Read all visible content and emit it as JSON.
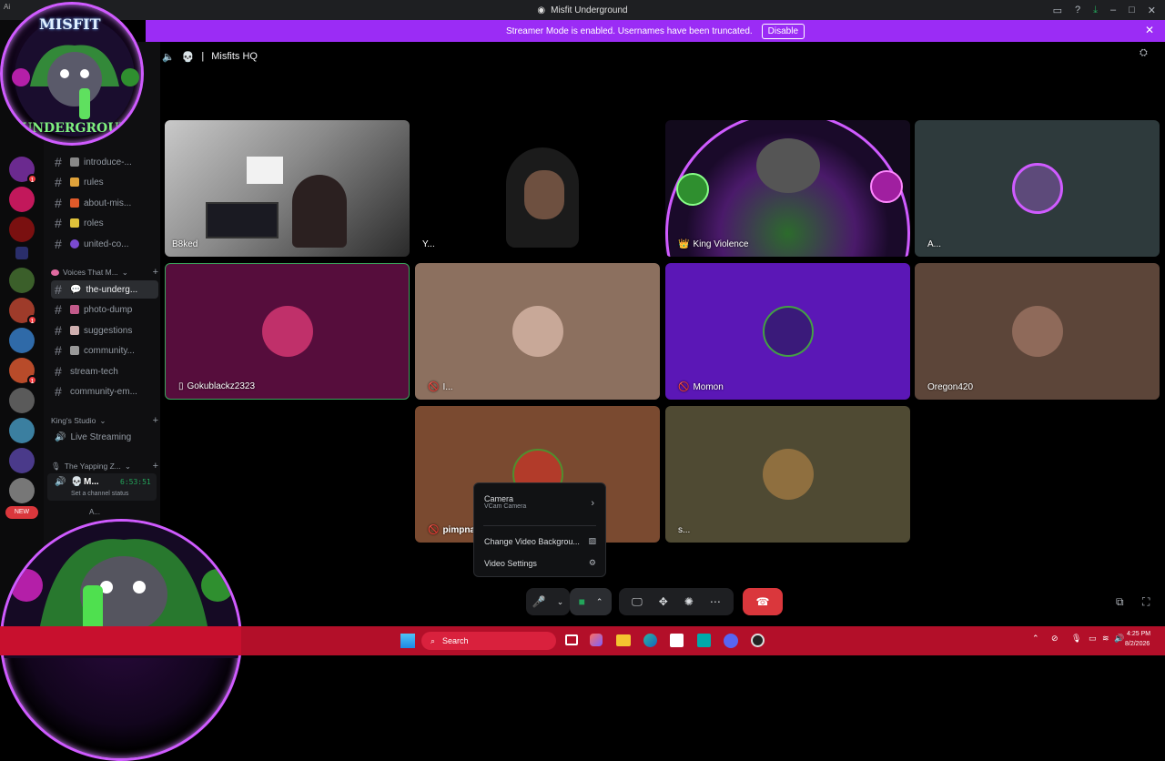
{
  "window": {
    "title": "Misfit Underground",
    "corner_label": "Ai"
  },
  "banner": {
    "text": "Streamer Mode is enabled. Usernames have been truncated.",
    "button": "Disable",
    "close": "✕"
  },
  "header": {
    "channel": "Misfits HQ",
    "separator": "|"
  },
  "channels": [
    {
      "name": "introduce-...",
      "top": 0
    },
    {
      "name": "rules"
    },
    {
      "name": "about-mis..."
    },
    {
      "name": "roles"
    },
    {
      "name": "united-co..."
    }
  ],
  "category_voices": "Voices That M...",
  "channels2": [
    {
      "name": "the-underg...",
      "active": true
    },
    {
      "name": "photo-dump"
    },
    {
      "name": "suggestions"
    },
    {
      "name": "community..."
    },
    {
      "name": "stream-tech"
    },
    {
      "name": "community-em..."
    }
  ],
  "category_kings": "King's Studio",
  "live_streaming": "Live Streaming",
  "category_yapping": "The Yapping Z...",
  "voice_user": {
    "name": "M...",
    "timer": "6:53:51",
    "status": "Set a channel status",
    "sub": "A..."
  },
  "new_badge": "NEW",
  "logo": {
    "top_word": "MISFIT",
    "bottom_word": "UNDERGROUND"
  },
  "tiles": [
    {
      "name": "B8ked"
    },
    {
      "name": "Y..."
    },
    {
      "name": "King Violence"
    },
    {
      "name": "A..."
    },
    {
      "name": "Gokublackz2323"
    },
    {
      "name": "I..."
    },
    {
      "name": "Momon"
    },
    {
      "name": "Oregon420"
    },
    {
      "name": "pimpna..."
    },
    {
      "name": "s..."
    }
  ],
  "popup": {
    "camera": "Camera",
    "camera_sub": "VCam Camera",
    "change_bg": "Change Video Backgrou...",
    "video_settings": "Video Settings"
  },
  "taskbar": {
    "search": "Search",
    "time": "4:25 PM",
    "date": "8/2/2026"
  },
  "colors": {
    "accent": "#9b2cf5",
    "hangup": "#da373c",
    "taskbar": "#c8102e"
  }
}
